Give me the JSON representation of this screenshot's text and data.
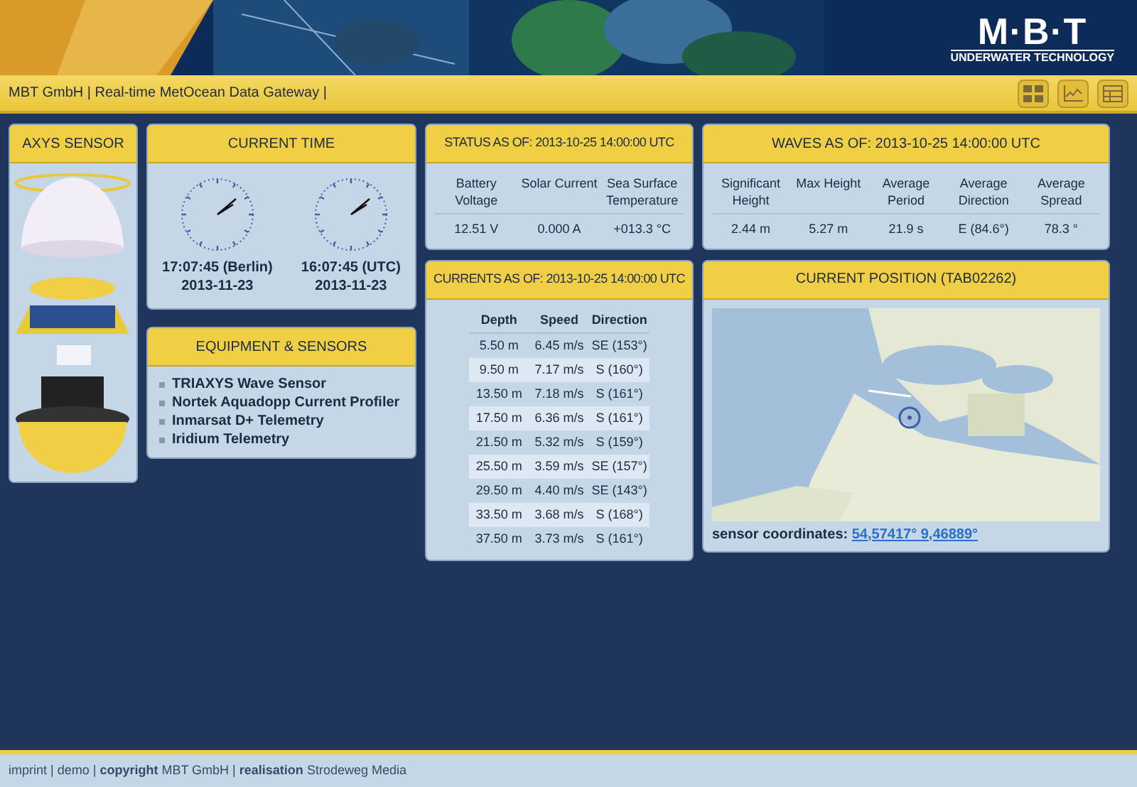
{
  "logo": {
    "mark": "M·B·T",
    "tagline": "UNDERWATER TECHNOLOGY"
  },
  "nav": {
    "title": "MBT GmbH | Real-time MetOcean Data Gateway |"
  },
  "sensor": {
    "title": "AXYS SENSOR"
  },
  "time": {
    "title": "CURRENT TIME",
    "clocks": [
      {
        "time": "17:07:45 (Berlin)",
        "date": "2013-11-23"
      },
      {
        "time": "16:07:45 (UTC)",
        "date": "2013-11-23"
      }
    ]
  },
  "equipment": {
    "title": "EQUIPMENT & SENSORS",
    "items": [
      "TRIAXYS Wave Sensor",
      "Nortek Aquadopp Current Profiler",
      "Inmarsat D+ Telemetry",
      "Iridium Telemetry"
    ]
  },
  "status": {
    "title": "STATUS AS OF: 2013-10-25 14:00:00 UTC",
    "columns": [
      "Battery Voltage",
      "Solar Current",
      "Sea Surface Temperature"
    ],
    "values": [
      "12.51 V",
      "0.000 A",
      "+013.3 °C"
    ]
  },
  "currents": {
    "title": "CURRENTS AS OF: 2013-10-25 14:00:00 UTC",
    "columns": [
      "Depth",
      "Speed",
      "Direction"
    ],
    "rows": [
      [
        "5.50 m",
        "6.45 m/s",
        "SE (153°)"
      ],
      [
        "9.50 m",
        "7.17 m/s",
        "S (160°)"
      ],
      [
        "13.50 m",
        "7.18 m/s",
        "S (161°)"
      ],
      [
        "17.50 m",
        "6.36 m/s",
        "S (161°)"
      ],
      [
        "21.50 m",
        "5.32 m/s",
        "S (159°)"
      ],
      [
        "25.50 m",
        "3.59 m/s",
        "SE (157°)"
      ],
      [
        "29.50 m",
        "4.40 m/s",
        "SE (143°)"
      ],
      [
        "33.50 m",
        "3.68 m/s",
        "S (168°)"
      ],
      [
        "37.50 m",
        "3.73 m/s",
        "S (161°)"
      ]
    ]
  },
  "waves": {
    "title": "WAVES AS OF: 2013-10-25 14:00:00 UTC",
    "columns": [
      "Significant Height",
      "Max Height",
      "Average Period",
      "Average Direction",
      "Average Spread"
    ],
    "values": [
      "2.44 m",
      "5.27 m",
      "21.9 s",
      "E (84.6°)",
      "78.3 °"
    ]
  },
  "position": {
    "title": "CURRENT POSITION (TAB02262)",
    "label": "sensor coordinates:",
    "link": "54,57417° 9,46889°"
  },
  "footer": {
    "text": "imprint | demo | **copyright** MBT GmbH | **realisation** Strodeweg Media"
  }
}
